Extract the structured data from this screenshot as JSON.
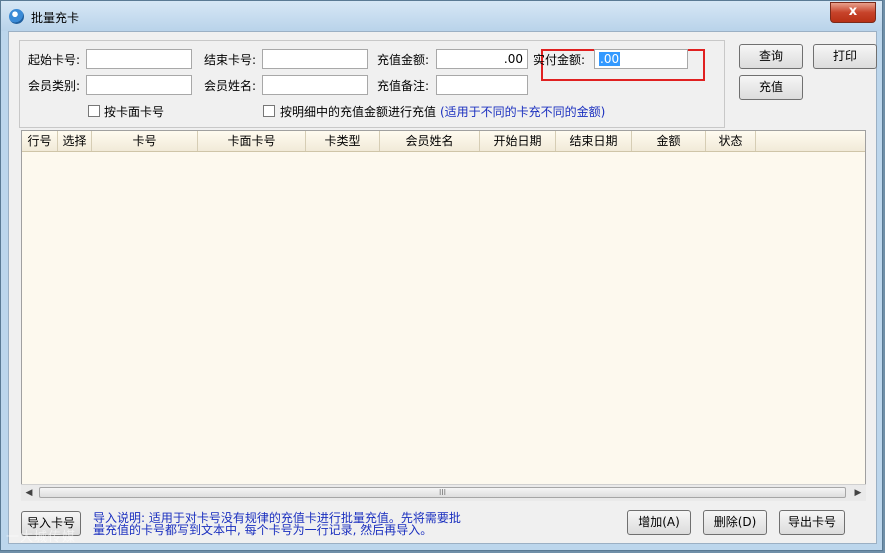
{
  "window": {
    "title": "批量充卡",
    "close_label": "x"
  },
  "form": {
    "start_card_label": "起始卡号:",
    "start_card_value": "",
    "end_card_label": "结束卡号:",
    "end_card_value": "",
    "recharge_amount_label": "充值金额:",
    "recharge_amount_value": ".00",
    "paid_amount_label": "实付金额:",
    "paid_amount_value": ".00",
    "member_type_label": "会员类别:",
    "member_type_value": "",
    "member_name_label": "会员姓名:",
    "member_name_value": "",
    "recharge_note_label": "充值备注:",
    "recharge_note_value": "",
    "by_face_card_label": "按卡面卡号",
    "by_detail_amount_label": "按明细中的充值金额进行充值",
    "by_detail_amount_hint": "(适用于不同的卡充不同的金额)"
  },
  "buttons": {
    "query": "查询",
    "print": "打印",
    "recharge": "充值",
    "import": "导入卡号",
    "add": "增加(A)",
    "delete": "删除(D)",
    "export": "导出卡号"
  },
  "table": {
    "columns": [
      "行号",
      "选择",
      "卡号",
      "卡面卡号",
      "卡类型",
      "会员姓名",
      "开始日期",
      "结束日期",
      "金额",
      "状态"
    ],
    "rows": []
  },
  "import_note": {
    "line1": "导入说明: 适用于对卡号没有规律的充值卡进行批量充值。先将需要批",
    "line2": "量充值的卡号都写到文本中, 每个卡号为一行记录, 然后再导入。"
  },
  "watermark": "一大城传媒"
}
